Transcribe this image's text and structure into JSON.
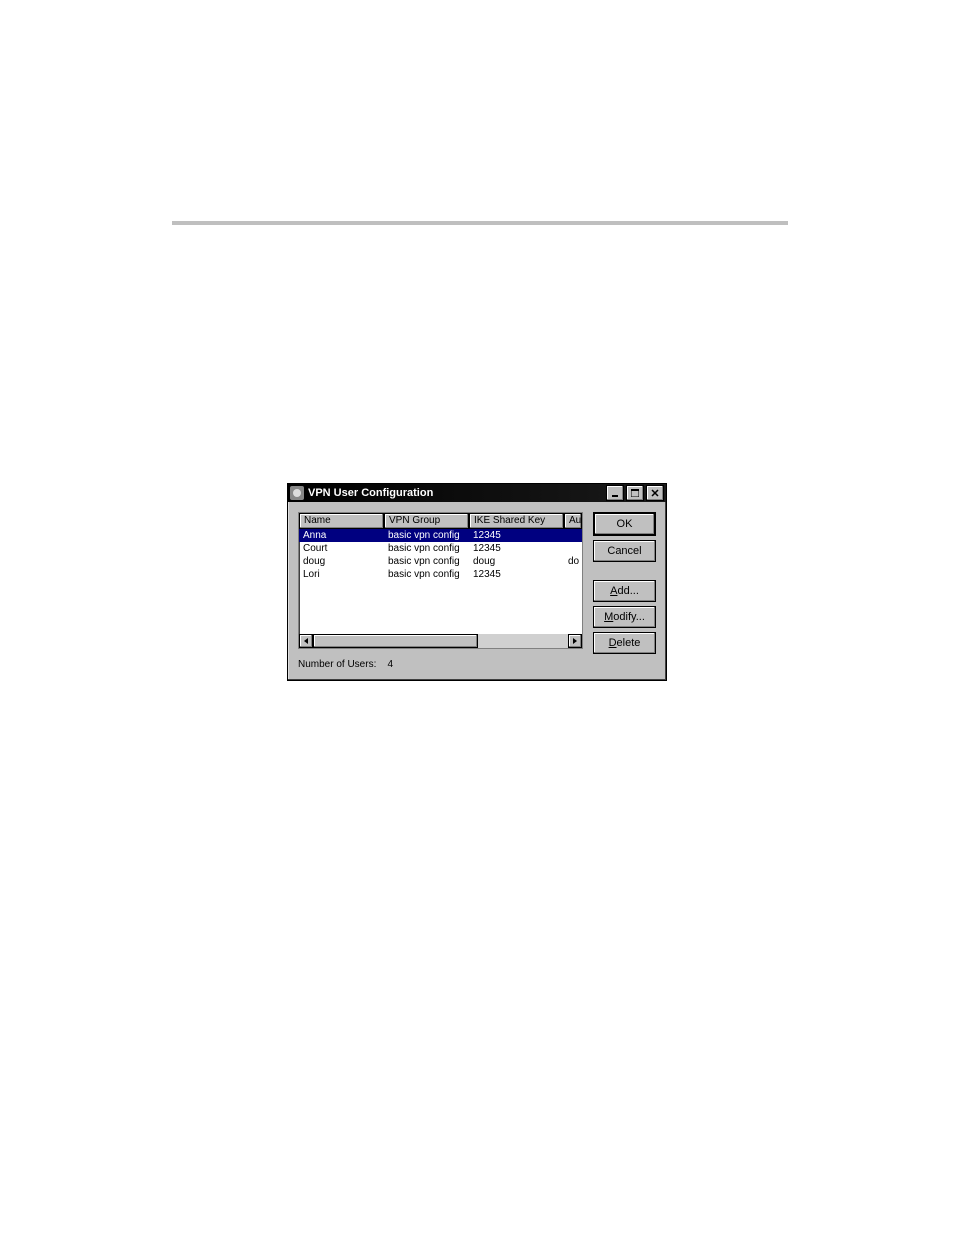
{
  "window": {
    "title": "VPN User Configuration"
  },
  "table": {
    "headers": {
      "name": "Name",
      "group": "VPN Group",
      "key": "IKE Shared Key",
      "au": "Au"
    },
    "rows": [
      {
        "name": "Anna",
        "group": "basic vpn config",
        "key": "12345",
        "au": "",
        "selected": true
      },
      {
        "name": "Court",
        "group": "basic vpn config",
        "key": "12345",
        "au": "",
        "selected": false
      },
      {
        "name": "doug",
        "group": "basic vpn config",
        "key": "doug",
        "au": "do",
        "selected": false
      },
      {
        "name": "Lori",
        "group": "basic vpn config",
        "key": "12345",
        "au": "",
        "selected": false
      }
    ]
  },
  "buttons": {
    "ok": "OK",
    "cancel": "Cancel",
    "add": "Add...",
    "modify": "Modify...",
    "delete": "Delete"
  },
  "status": {
    "label": "Number of Users:",
    "value": "4"
  }
}
